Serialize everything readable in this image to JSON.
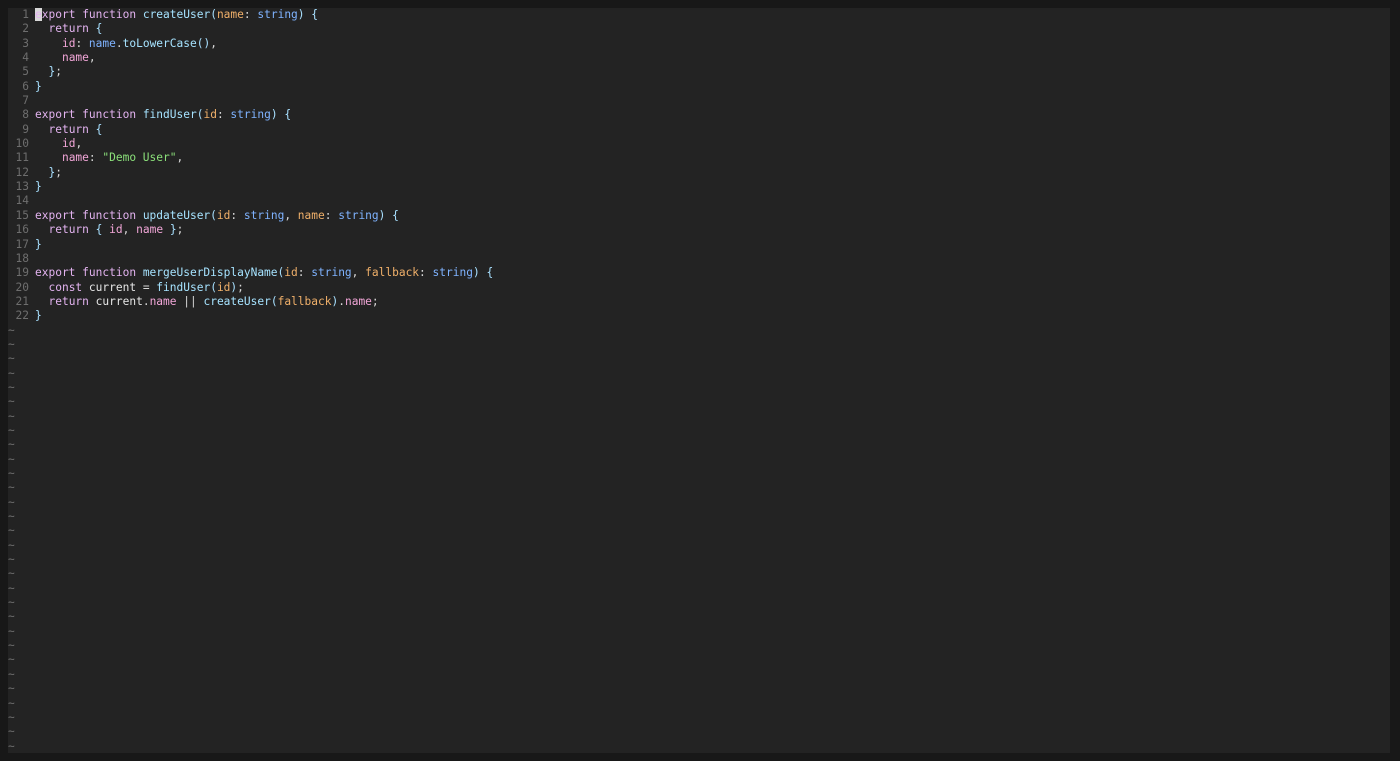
{
  "editor": {
    "colors": {
      "background": "#232323",
      "page_background": "#181818",
      "line_number": "#6e6e6e",
      "keyword": "#e3b3f0",
      "function": "#a6e3ff",
      "parameter": "#f0b06a",
      "type": "#7fb3ff",
      "property": "#f2a6d8",
      "string": "#8be07a"
    },
    "cursor": {
      "line": 1,
      "column": 1
    },
    "tilde_count": 30,
    "tilde_char": "~",
    "lines": [
      {
        "n": "1",
        "tokens": [
          [
            "keyword",
            "export"
          ],
          [
            "ws",
            " "
          ],
          [
            "keyword",
            "function"
          ],
          [
            "ws",
            " "
          ],
          [
            "func",
            "createUser"
          ],
          [
            "brace",
            "("
          ],
          [
            "param",
            "name"
          ],
          [
            "punct",
            ": "
          ],
          [
            "type",
            "string"
          ],
          [
            "brace",
            ")"
          ],
          [
            "ws",
            " "
          ],
          [
            "brace",
            "{"
          ]
        ]
      },
      {
        "n": "2",
        "tokens": [
          [
            "ws",
            "  "
          ],
          [
            "keyword",
            "return"
          ],
          [
            "ws",
            " "
          ],
          [
            "brace",
            "{"
          ]
        ]
      },
      {
        "n": "3",
        "tokens": [
          [
            "ws",
            "    "
          ],
          [
            "prop",
            "id"
          ],
          [
            "punct",
            ": "
          ],
          [
            "type",
            "name"
          ],
          [
            "punct",
            "."
          ],
          [
            "func",
            "toLowerCase"
          ],
          [
            "brace",
            "()"
          ],
          [
            "punct",
            ","
          ]
        ]
      },
      {
        "n": "4",
        "tokens": [
          [
            "ws",
            "    "
          ],
          [
            "prop",
            "name"
          ],
          [
            "punct",
            ","
          ]
        ]
      },
      {
        "n": "5",
        "tokens": [
          [
            "ws",
            "  "
          ],
          [
            "brace",
            "}"
          ],
          [
            "punct",
            ";"
          ]
        ]
      },
      {
        "n": "6",
        "tokens": [
          [
            "brace",
            "}"
          ]
        ]
      },
      {
        "n": "7",
        "tokens": []
      },
      {
        "n": "8",
        "tokens": [
          [
            "keyword",
            "export"
          ],
          [
            "ws",
            " "
          ],
          [
            "keyword",
            "function"
          ],
          [
            "ws",
            " "
          ],
          [
            "func",
            "findUser"
          ],
          [
            "brace",
            "("
          ],
          [
            "param",
            "id"
          ],
          [
            "punct",
            ": "
          ],
          [
            "type",
            "string"
          ],
          [
            "brace",
            ")"
          ],
          [
            "ws",
            " "
          ],
          [
            "brace",
            "{"
          ]
        ]
      },
      {
        "n": "9",
        "tokens": [
          [
            "ws",
            "  "
          ],
          [
            "keyword",
            "return"
          ],
          [
            "ws",
            " "
          ],
          [
            "brace",
            "{"
          ]
        ]
      },
      {
        "n": "10",
        "tokens": [
          [
            "ws",
            "    "
          ],
          [
            "prop",
            "id"
          ],
          [
            "punct",
            ","
          ]
        ]
      },
      {
        "n": "11",
        "tokens": [
          [
            "ws",
            "    "
          ],
          [
            "prop",
            "name"
          ],
          [
            "punct",
            ": "
          ],
          [
            "string",
            "\"Demo User\""
          ],
          [
            "punct",
            ","
          ]
        ]
      },
      {
        "n": "12",
        "tokens": [
          [
            "ws",
            "  "
          ],
          [
            "brace",
            "}"
          ],
          [
            "punct",
            ";"
          ]
        ]
      },
      {
        "n": "13",
        "tokens": [
          [
            "brace",
            "}"
          ]
        ]
      },
      {
        "n": "14",
        "tokens": []
      },
      {
        "n": "15",
        "tokens": [
          [
            "keyword",
            "export"
          ],
          [
            "ws",
            " "
          ],
          [
            "keyword",
            "function"
          ],
          [
            "ws",
            " "
          ],
          [
            "func",
            "updateUser"
          ],
          [
            "brace",
            "("
          ],
          [
            "param",
            "id"
          ],
          [
            "punct",
            ": "
          ],
          [
            "type",
            "string"
          ],
          [
            "punct",
            ", "
          ],
          [
            "param",
            "name"
          ],
          [
            "punct",
            ": "
          ],
          [
            "type",
            "string"
          ],
          [
            "brace",
            ")"
          ],
          [
            "ws",
            " "
          ],
          [
            "brace",
            "{"
          ]
        ]
      },
      {
        "n": "16",
        "tokens": [
          [
            "ws",
            "  "
          ],
          [
            "keyword",
            "return"
          ],
          [
            "ws",
            " "
          ],
          [
            "brace",
            "{"
          ],
          [
            "ws",
            " "
          ],
          [
            "prop",
            "id"
          ],
          [
            "punct",
            ", "
          ],
          [
            "prop",
            "name"
          ],
          [
            "ws",
            " "
          ],
          [
            "brace",
            "}"
          ],
          [
            "punct",
            ";"
          ]
        ]
      },
      {
        "n": "17",
        "tokens": [
          [
            "brace",
            "}"
          ]
        ]
      },
      {
        "n": "18",
        "tokens": []
      },
      {
        "n": "19",
        "tokens": [
          [
            "keyword",
            "export"
          ],
          [
            "ws",
            " "
          ],
          [
            "keyword",
            "function"
          ],
          [
            "ws",
            " "
          ],
          [
            "func",
            "mergeUserDisplayName"
          ],
          [
            "brace",
            "("
          ],
          [
            "param",
            "id"
          ],
          [
            "punct",
            ": "
          ],
          [
            "type",
            "string"
          ],
          [
            "punct",
            ", "
          ],
          [
            "param",
            "fallback"
          ],
          [
            "punct",
            ": "
          ],
          [
            "type",
            "string"
          ],
          [
            "brace",
            ")"
          ],
          [
            "ws",
            " "
          ],
          [
            "brace",
            "{"
          ]
        ]
      },
      {
        "n": "20",
        "tokens": [
          [
            "ws",
            "  "
          ],
          [
            "keyword",
            "const"
          ],
          [
            "ws",
            " "
          ],
          [
            "ident",
            "current"
          ],
          [
            "op",
            " = "
          ],
          [
            "func",
            "findUser"
          ],
          [
            "brace",
            "("
          ],
          [
            "param",
            "id"
          ],
          [
            "brace",
            ")"
          ],
          [
            "punct",
            ";"
          ]
        ]
      },
      {
        "n": "21",
        "tokens": [
          [
            "ws",
            "  "
          ],
          [
            "keyword",
            "return"
          ],
          [
            "ws",
            " "
          ],
          [
            "ident",
            "current"
          ],
          [
            "punct",
            "."
          ],
          [
            "prop",
            "name"
          ],
          [
            "op",
            " || "
          ],
          [
            "func",
            "createUser"
          ],
          [
            "brace",
            "("
          ],
          [
            "param",
            "fallback"
          ],
          [
            "brace",
            ")"
          ],
          [
            "punct",
            "."
          ],
          [
            "prop",
            "name"
          ],
          [
            "punct",
            ";"
          ]
        ]
      },
      {
        "n": "22",
        "tokens": [
          [
            "brace",
            "}"
          ]
        ]
      }
    ]
  }
}
